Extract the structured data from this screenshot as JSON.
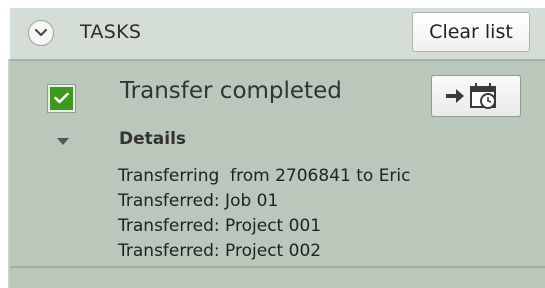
{
  "header": {
    "title": "TASKS",
    "clear_label": "Clear list"
  },
  "task": {
    "status": "Transfer completed",
    "checked": true,
    "details_label": "Details",
    "details_lines": [
      "Transferring  from 2706841 to Eric",
      "Transferred: Job 01",
      "Transferred: Project 001",
      "Transferred: Project 002"
    ]
  },
  "icons": {
    "collapse": "chevron-down-icon",
    "check": "checkmark-icon",
    "details_toggle": "triangle-down-icon",
    "open": "arrow-to-schedule-icon"
  },
  "colors": {
    "header_bg": "#d4ddd6",
    "task_bg": "#b9c8bb",
    "check_green": "#3d9a1e"
  }
}
